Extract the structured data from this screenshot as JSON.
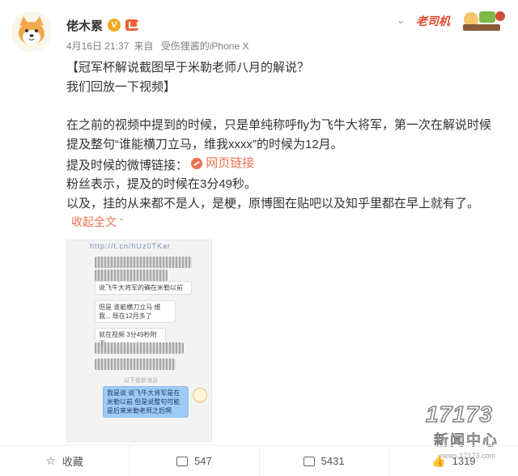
{
  "user": {
    "name": "佬木累",
    "verified_mark": "V",
    "icons": {
      "avatar": "shiba-dog-avatar",
      "verified": "verified-v-icon",
      "member": "vip-member-icon"
    }
  },
  "meta": {
    "date": "4月16日 21:37",
    "source_prefix": "来自",
    "device": "受伤狸酱的iPhone X"
  },
  "header_badge": {
    "text": "老司机"
  },
  "post": {
    "line1": "【冠军杯解说截图早于米勒老师八月的解说？",
    "line2": "我们回放一下视频】",
    "line3": "在之前的视频中提到的时候，只是单纯称呼fly为飞牛大将军，第一次在解说时候",
    "line4": "提及整句“谁能横刀立马，维我xxxx”的时候为12月。",
    "line5_prefix": "提及时候的微博链接：",
    "link_label": "网页链接",
    "line6": "粉丝表示，提及的时候在3分49秒。",
    "line7": "以及，挂的从来都不是人，是梗，原博图在贴吧以及知乎里都在早上就有了。",
    "collapse_label": "收起全文"
  },
  "embedded_image": {
    "url_text": "http://t.cn/hUz0TKar",
    "bubbles": [
      "说飞牛大将军的确在米勒以前",
      "但是 谁能横刀立马 维我... 既在12月多了",
      "就在视频 3分49秒附近"
    ],
    "divider": "以下是新消息",
    "reply": "我是说 说飞牛大将军是在米勒以前 但是说整句可能是后来米勒老师之后啊"
  },
  "footer": {
    "favorite_label": "收藏",
    "share_count": "547",
    "comment_count": "5431",
    "like_count": "1319"
  },
  "watermark": {
    "logo": "17173",
    "title": "新闻中心",
    "url": "news.17173.com"
  }
}
